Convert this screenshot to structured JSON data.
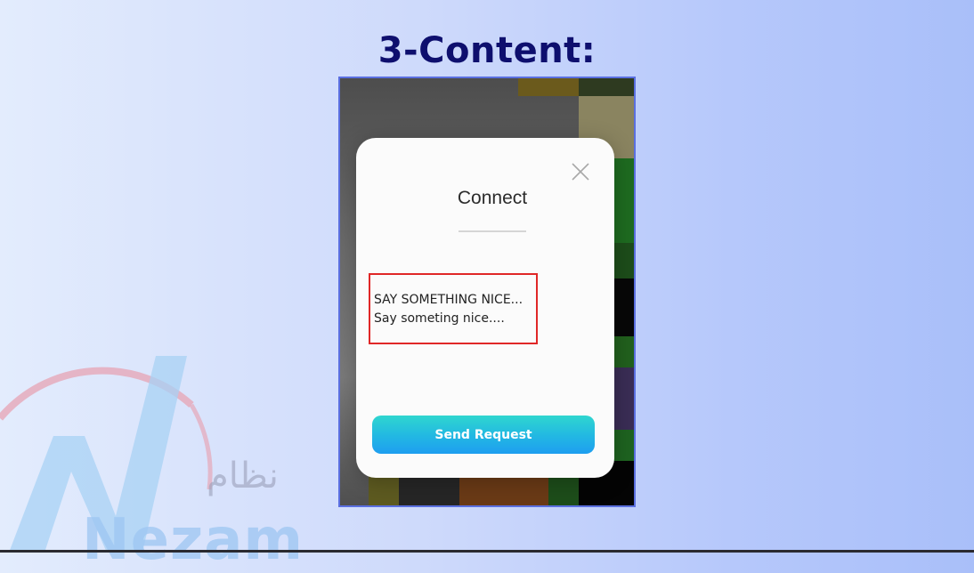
{
  "slide": {
    "heading": "3-Content:"
  },
  "watermark": {
    "brand_latin": "Nezam",
    "brand_arabic": "نظام"
  },
  "dialog": {
    "title": "Connect",
    "close_icon": "close-icon",
    "message_placeholder": "SAY SOMETHING NICE...",
    "message_value": "Say someting nice....",
    "send_button_label": "Send Request"
  },
  "colors": {
    "heading": "#0e0f6e",
    "highlight_box": "#e02727",
    "button_gradient_start": "#2fd6cf",
    "button_gradient_end": "#1e9ef0",
    "phone_frame": "#5a6fe0"
  }
}
